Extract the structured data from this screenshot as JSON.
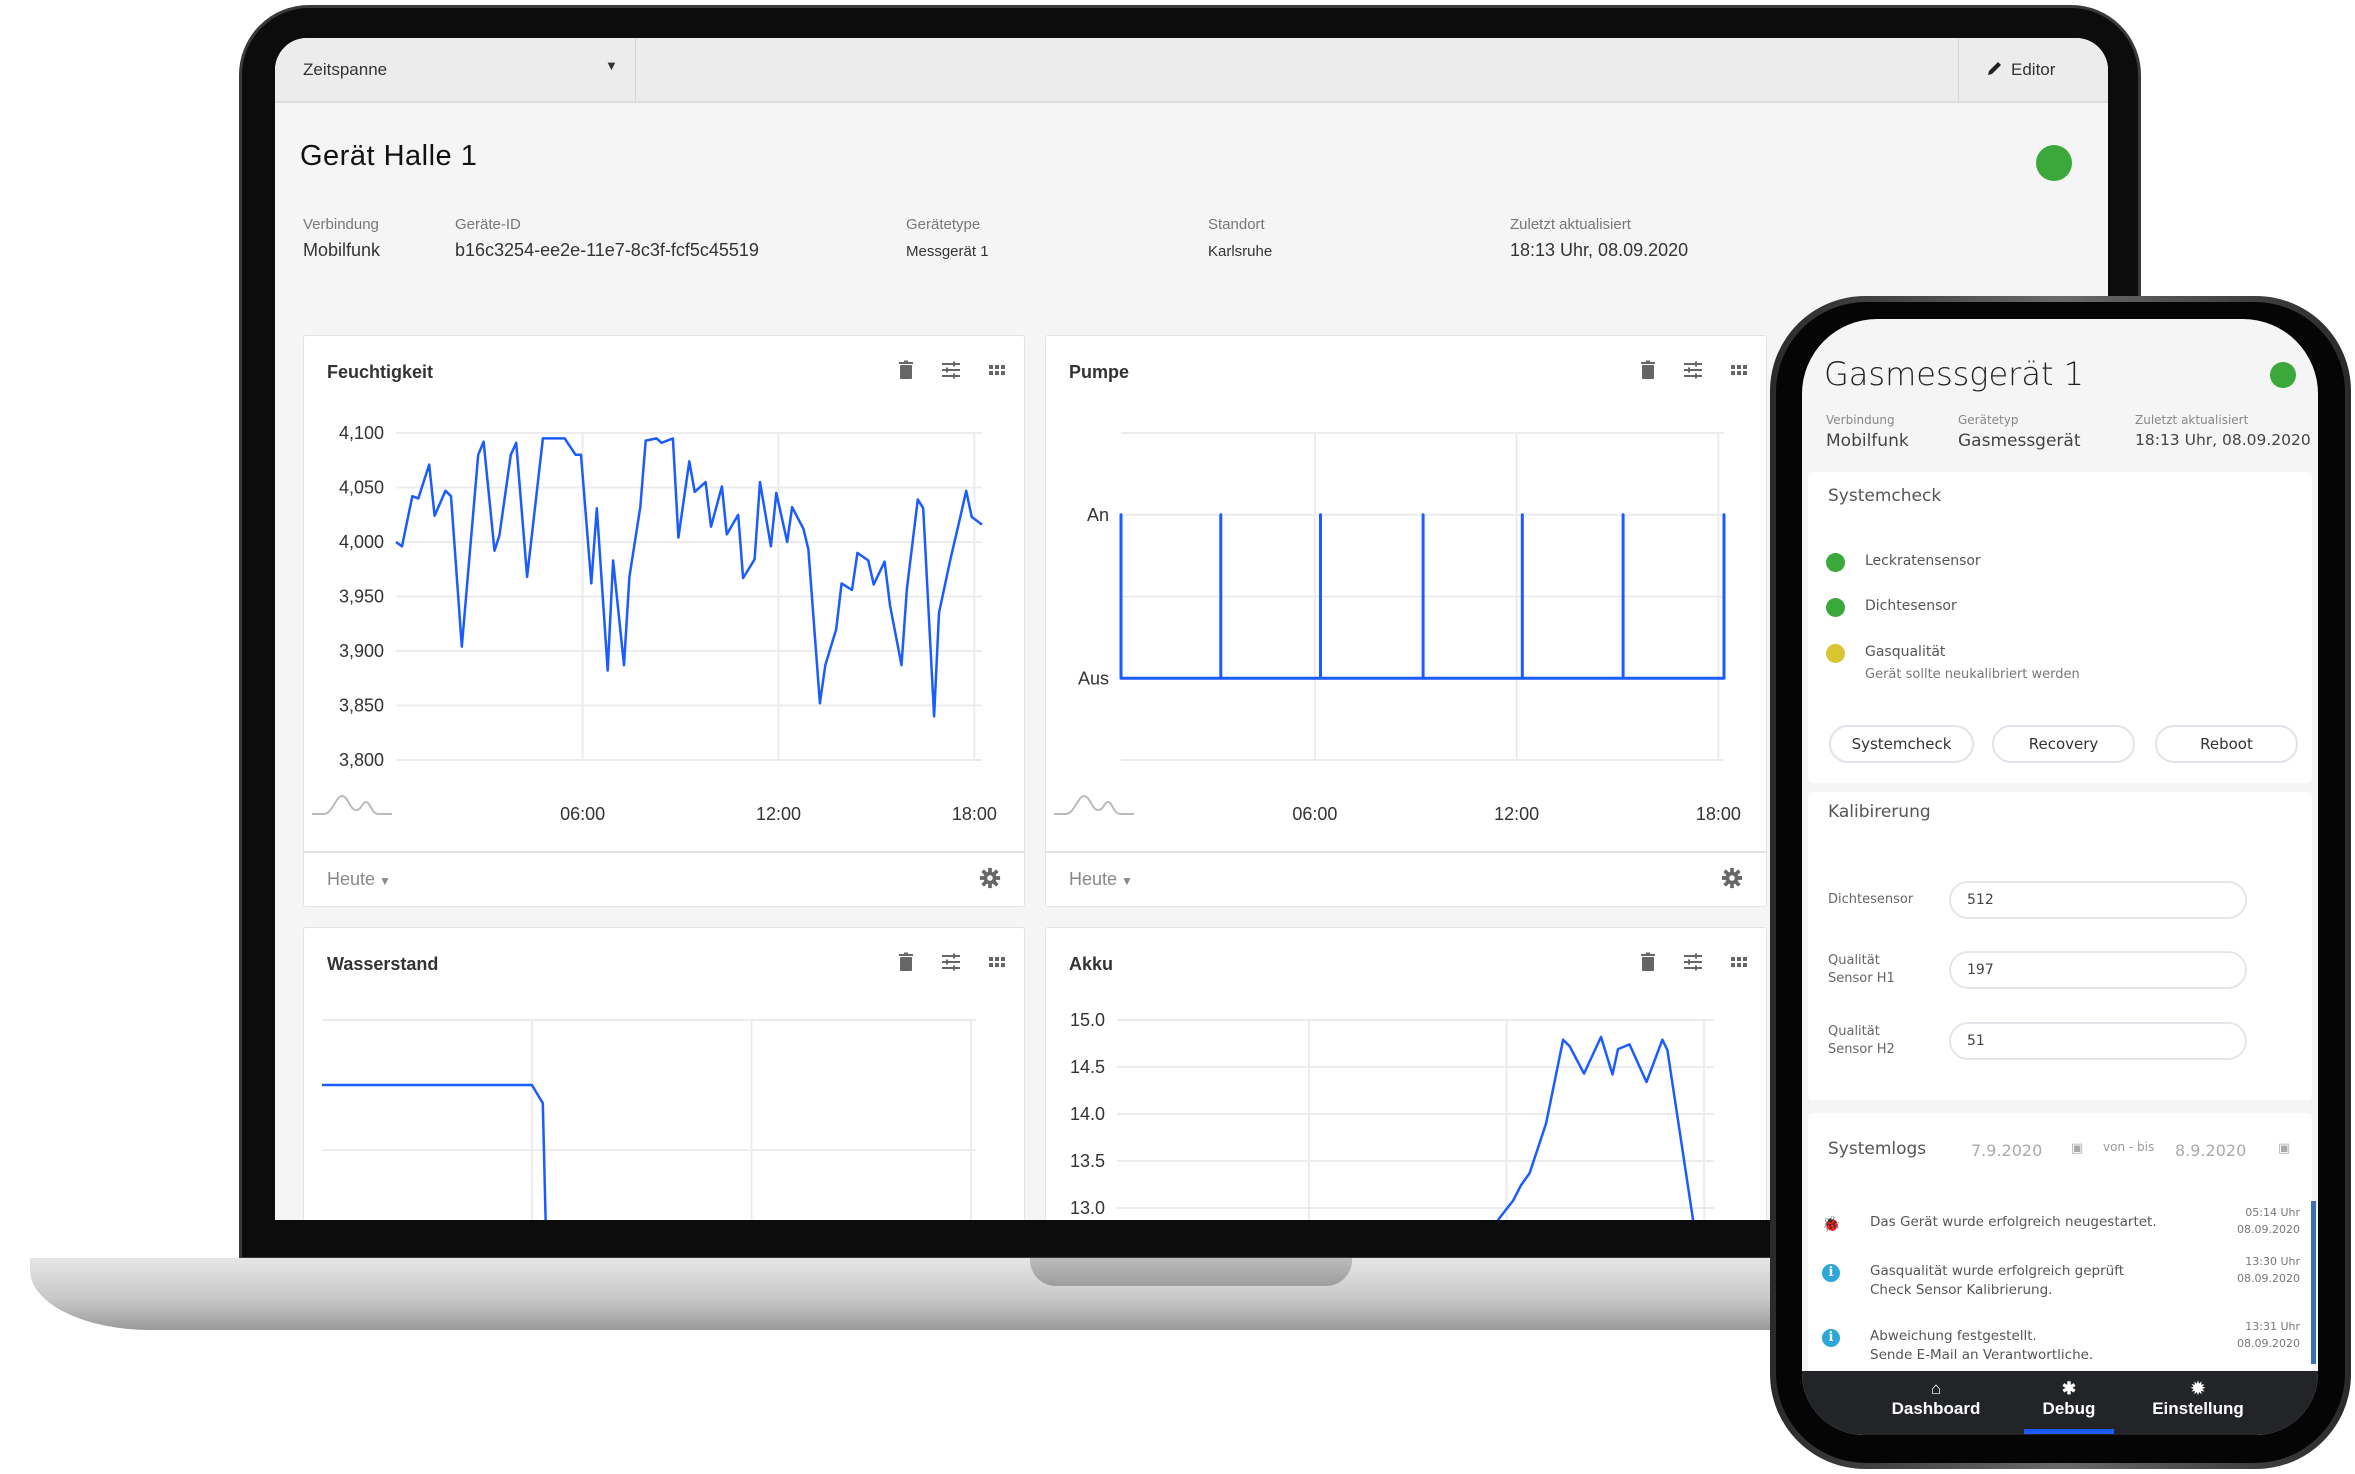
{
  "laptop": {
    "toolbar": {
      "timespan_label": "Zeitspanne",
      "editor_label": "Editor"
    },
    "device": {
      "title": "Gerät Halle 1",
      "status_color": "#3aa83a",
      "info": [
        {
          "label": "Verbindung",
          "value": "Mobilfunk"
        },
        {
          "label": "Geräte-ID",
          "value": "b16c3254-ee2e-11e7-8c3f-fcf5c45519"
        },
        {
          "label": "Gerätetype",
          "value": "Messgerät 1"
        },
        {
          "label": "Standort",
          "value": "Karlsruhe"
        },
        {
          "label": "Zuletzt aktualisiert",
          "value": "18:13 Uhr, 08.09.2020"
        }
      ]
    },
    "cards": [
      {
        "title": "Feuchtigkeit",
        "range": "Heute"
      },
      {
        "title": "Pumpe",
        "range": "Heute"
      },
      {
        "title": "Wasserstand"
      },
      {
        "title": "Akku"
      }
    ]
  },
  "chart_data": [
    {
      "type": "line",
      "title": "Feuchtigkeit",
      "line_color": "#1a5cff",
      "grid": true,
      "xlim": [
        "00:17",
        "18:14"
      ],
      "xticks": [
        "06:00",
        "12:00",
        "18:00"
      ],
      "ylim": [
        3800,
        4100
      ],
      "yticks": [
        "3,800",
        "3,850",
        "3,900",
        "3,950",
        "4,000",
        "4,050",
        "4,100"
      ],
      "ytick_values": [
        3800,
        3850,
        3900,
        3950,
        4000,
        4050,
        4100
      ],
      "points": [
        [
          "00:17",
          4000
        ],
        [
          "00:28",
          3996
        ],
        [
          "00:47",
          4042
        ],
        [
          "00:58",
          4040
        ],
        [
          "01:18",
          4071
        ],
        [
          "01:28",
          4024
        ],
        [
          "01:48",
          4047
        ],
        [
          "01:58",
          4042
        ],
        [
          "02:18",
          3904
        ],
        [
          "02:48",
          4080
        ],
        [
          "02:58",
          4092
        ],
        [
          "03:18",
          3992
        ],
        [
          "03:27",
          4006
        ],
        [
          "03:48",
          4080
        ],
        [
          "03:58",
          4091
        ],
        [
          "04:18",
          3968
        ],
        [
          "04:47",
          4095
        ],
        [
          "05:27",
          4095
        ],
        [
          "05:47",
          4080
        ],
        [
          "05:57",
          4080
        ],
        [
          "06:16",
          3962
        ],
        [
          "06:26",
          4031
        ],
        [
          "06:46",
          3882
        ],
        [
          "06:56",
          3983
        ],
        [
          "07:16",
          3887
        ],
        [
          "07:26",
          3968
        ],
        [
          "07:46",
          4032
        ],
        [
          "07:56",
          4093
        ],
        [
          "08:16",
          4095
        ],
        [
          "08:25",
          4091
        ],
        [
          "08:46",
          4095
        ],
        [
          "08:56",
          4004
        ],
        [
          "09:16",
          4074
        ],
        [
          "09:26",
          4046
        ],
        [
          "09:46",
          4055
        ],
        [
          "09:56",
          4014
        ],
        [
          "10:16",
          4051
        ],
        [
          "10:25",
          4007
        ],
        [
          "10:46",
          4025
        ],
        [
          "10:55",
          3967
        ],
        [
          "11:16",
          3984
        ],
        [
          "11:26",
          4055
        ],
        [
          "11:46",
          3996
        ],
        [
          "11:56",
          4045
        ],
        [
          "12:16",
          4000
        ],
        [
          "12:25",
          4032
        ],
        [
          "12:46",
          4012
        ],
        [
          "12:55",
          3993
        ],
        [
          "13:16",
          3852
        ],
        [
          "13:26",
          3887
        ],
        [
          "13:46",
          3920
        ],
        [
          "13:56",
          3962
        ],
        [
          "14:15",
          3956
        ],
        [
          "14:25",
          3990
        ],
        [
          "14:45",
          3983
        ],
        [
          "14:55",
          3961
        ],
        [
          "15:15",
          3982
        ],
        [
          "15:25",
          3942
        ],
        [
          "15:46",
          3887
        ],
        [
          "15:56",
          3957
        ],
        [
          "16:16",
          4039
        ],
        [
          "16:26",
          4031
        ],
        [
          "16:46",
          3840
        ],
        [
          "16:55",
          3935
        ],
        [
          "17:16",
          3984
        ],
        [
          "17:35",
          4025
        ],
        [
          "17:45",
          4047
        ],
        [
          "17:55",
          4023
        ],
        [
          "18:14",
          4016
        ]
      ]
    },
    {
      "type": "line",
      "title": "Pumpe",
      "line_color": "#1a5cff",
      "grid": true,
      "xlim": [
        "00:14",
        "18:10"
      ],
      "xticks": [
        "06:00",
        "12:00",
        "18:00"
      ],
      "ycategories": [
        "Aus",
        "An"
      ],
      "ylim": [
        -0.5,
        1.5
      ],
      "on_pulses": [
        "00:14",
        "03:12",
        "06:10",
        "09:13",
        "12:10",
        "15:10",
        "18:10"
      ]
    },
    {
      "type": "line",
      "title": "Wasserstand",
      "line_color": "#1a5cff",
      "grid": true,
      "xlim": [
        "00:16",
        "18:08"
      ],
      "xticks": [
        "06:00",
        "12:00",
        "18:00"
      ],
      "xtick_labels_visible": false,
      "ylim": [
        0,
        3
      ],
      "ytick_values": [
        0,
        1,
        2,
        3
      ],
      "points": [
        [
          "00:16",
          2.5
        ],
        [
          "06:00",
          2.5
        ],
        [
          "06:18",
          2.36
        ],
        [
          "06:30",
          0
        ]
      ]
    },
    {
      "type": "line",
      "title": "Akku",
      "line_color": "#1a5cff",
      "grid": true,
      "xlim": [
        "00:10",
        "18:18"
      ],
      "xticks": [
        "06:00",
        "12:00",
        "18:00"
      ],
      "xtick_labels_visible": false,
      "ylim": [
        12.0,
        15.0
      ],
      "yticks": [
        "13.0",
        "13.5",
        "14.0",
        "14.5",
        "15.0"
      ],
      "ytick_values": [
        13.0,
        13.5,
        14.0,
        14.5,
        15.0
      ],
      "points": [
        [
          "11:44",
          12.87
        ],
        [
          "12:12",
          13.08
        ],
        [
          "12:26",
          13.24
        ],
        [
          "12:42",
          13.37
        ],
        [
          "13:12",
          13.9
        ],
        [
          "13:43",
          14.79
        ],
        [
          "13:55",
          14.72
        ],
        [
          "14:21",
          14.43
        ],
        [
          "14:52",
          14.82
        ],
        [
          "15:13",
          14.42
        ],
        [
          "15:23",
          14.69
        ],
        [
          "15:44",
          14.74
        ],
        [
          "16:15",
          14.34
        ],
        [
          "16:44",
          14.79
        ],
        [
          "16:53",
          14.68
        ],
        [
          "17:40",
          12.87
        ]
      ]
    }
  ],
  "phone": {
    "title": "Gasmessgerät 1",
    "status_color": "#3aa83a",
    "info": [
      {
        "label": "Verbindung",
        "value": "Mobilfunk"
      },
      {
        "label": "Gerätetyp",
        "value": "Gasmessgerät"
      },
      {
        "label": "Zuletzt aktualisiert",
        "value": "18:13 Uhr, 08.09.2020"
      }
    ],
    "systemcheck": {
      "title": "Systemcheck",
      "items": [
        {
          "label": "Leckratensensor",
          "color": "#3aa83a"
        },
        {
          "label": "Dichtesensor",
          "color": "#3aa83a"
        },
        {
          "label": "Gasqualität",
          "color": "#d9c431",
          "note": "Gerät sollte neukalibriert werden"
        }
      ],
      "buttons": [
        "Systemcheck",
        "Recovery",
        "Reboot"
      ]
    },
    "calibration": {
      "title": "Kalibirerung",
      "fields": [
        {
          "label": "Dichtesensor",
          "value": "512"
        },
        {
          "label": "Qualität\nSensor H1",
          "value": "197"
        },
        {
          "label": "Qualität\nSensor H2",
          "value": "51"
        }
      ]
    },
    "logs": {
      "title": "Systemlogs",
      "from": "7.9.2020",
      "range_label": "von - bis",
      "to": "8.9.2020",
      "entries": [
        {
          "icon": "bug-icon",
          "line1": "Das Gerät wurde erfolgreich neugestartet.",
          "line2": "",
          "time": "05:14 Uhr",
          "date": "08.09.2020"
        },
        {
          "icon": "info-icon",
          "line1": "Gasqualität wurde erfolgreich geprüft",
          "line2": "Check Sensor Kalibrierung.",
          "time": "13:30 Uhr",
          "date": "08.09.2020"
        },
        {
          "icon": "info-icon",
          "line1": "Abweichung festgestellt.",
          "line2": "Sende E-Mail an Verantwortliche.",
          "time": "13:31 Uhr",
          "date": "08.09.2020"
        }
      ]
    },
    "nav": [
      {
        "label": "Dashboard",
        "icon": "home-icon"
      },
      {
        "label": "Debug",
        "icon": "bug-icon",
        "active": true
      },
      {
        "label": "Einstellung",
        "icon": "gear-icon"
      }
    ],
    "accent": "#1a5cff"
  }
}
